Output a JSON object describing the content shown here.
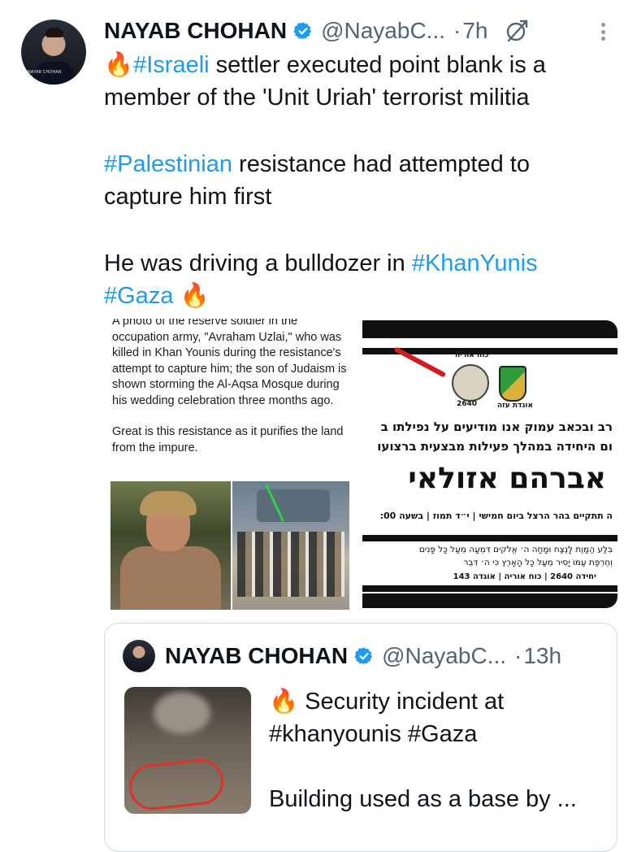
{
  "tweet": {
    "author_name": "NAYAB CHOHAN",
    "handle": "@NayabC...",
    "separator": "·",
    "time": "7h",
    "avatar_caption": "NAYAB CHOHAN",
    "text": {
      "line1_fire": "🔥",
      "line1_tag": "#Israeli",
      "line1_rest": " settler executed point blank is a member of the 'Unit Uriah' terrorist militia",
      "para2_tag": "#Palestinian",
      "para2_rest": " resistance had attempted to capture him first",
      "para3_text": "He was driving a bulldozer in ",
      "para3_tag1": "#KhanYunis",
      "para3_tag2": "#Gaza",
      "para3_fire": " 🔥"
    }
  },
  "media": {
    "caption_top": "A photo of the reserve soldier in the occupation army, \"Avraham Uzlai,\" who was killed in Khan Younis during the resistance's attempt to capture him; the son of Judaism is shown storming the Al-Aqsa Mosque during his wedding celebration three months ago.",
    "caption_bottom": "Great is this resistance as it purifies the land from the impure.",
    "poster": {
      "emblem_label_left": "כוח אוריה",
      "emblem_label_right": "אוגדת עזה",
      "emblem_year": "2640",
      "line1": "רב ובכאב עמוק אנו מודיעים על נפילתו ב",
      "line2": "ום היחידה במהלך פעילות מבצעית ברצועו",
      "name": "אברהם אזולאי",
      "line3": "ה תתקיים בהר הרצל ביום חמישי | י״ד תמוז | בשעה 00:",
      "verse1": "בִּלַּע הַמָּוֶת לָנֶצַח וּמָחָה ה׳ אֱלֹקִים דִּמְעָה מֵעַל כָּל פָּנִים",
      "verse2": "וְחֶרְפַּת עַמּוֹ יָסִיר מֵעַל כָּל הָאָרֶץ כִּי ה׳ דִּבֵּר",
      "footer": "יחידה 2640 | כוח אוריה | אוגדה 143"
    }
  },
  "quote": {
    "author_name": "NAYAB CHOHAN",
    "handle": "@NayabC...",
    "separator": "·",
    "time": "13h",
    "text_fire": "🔥",
    "text_line1": " Security incident at",
    "text_tags": "#khanyounis #Gaza",
    "text_line3": "Building used as a base by ..."
  },
  "colors": {
    "link": "#1d9bf0",
    "verified": "#1d9bf0",
    "secondary_text": "#536471",
    "border": "#cfd9de"
  },
  "icons": [
    "verified-badge-icon",
    "grok-icon",
    "more-options-icon",
    "fire-emoji-icon"
  ]
}
